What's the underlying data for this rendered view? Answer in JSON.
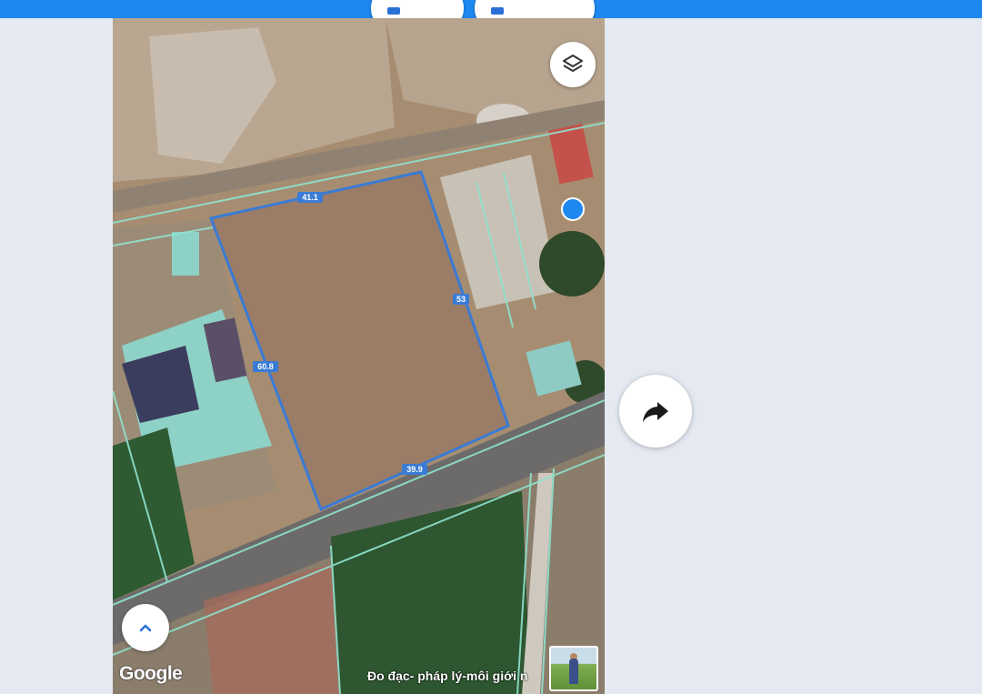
{
  "map": {
    "measurements": {
      "top_edge": "41.1",
      "right_edge": "53",
      "left_edge": "60.8",
      "bottom_edge": "39.9"
    },
    "attribution": "Google",
    "caption": "Đo đạc- pháp lý-môi giới n"
  },
  "colors": {
    "top_bar": "#1e88f0",
    "parcel_outline": "#3a7bd5",
    "cadastral_lines": "#8fe3cf",
    "location_dot": "#1e88f0"
  },
  "icons": {
    "layers": "layers-icon",
    "collapse": "chevron-up-icon",
    "share": "share-arrow-icon"
  }
}
